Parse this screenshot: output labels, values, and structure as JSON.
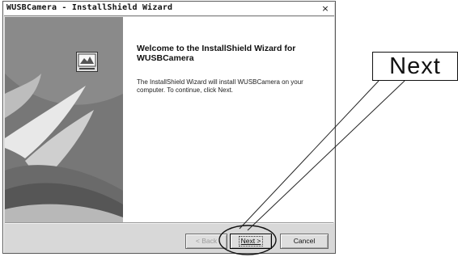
{
  "window": {
    "title": "WUSBCamera - InstallShield Wizard",
    "close_glyph": "×"
  },
  "icons": {
    "banner_icon": "setup-computer-icon",
    "close_icon": "close-icon"
  },
  "content": {
    "heading": "Welcome to the InstallShield Wizard for WUSBCamera",
    "body": "The InstallShield Wizard will install WUSBCamera on your computer.  To continue, click Next."
  },
  "buttons": {
    "back_label": "< Back",
    "next_label": "Next >",
    "cancel_label": "Cancel"
  },
  "annotation": {
    "label": "Next"
  },
  "colors": {
    "banner_background": "#8c8c8c",
    "content_background": "#ffffff",
    "dialog_face": "#d8d8d8"
  }
}
